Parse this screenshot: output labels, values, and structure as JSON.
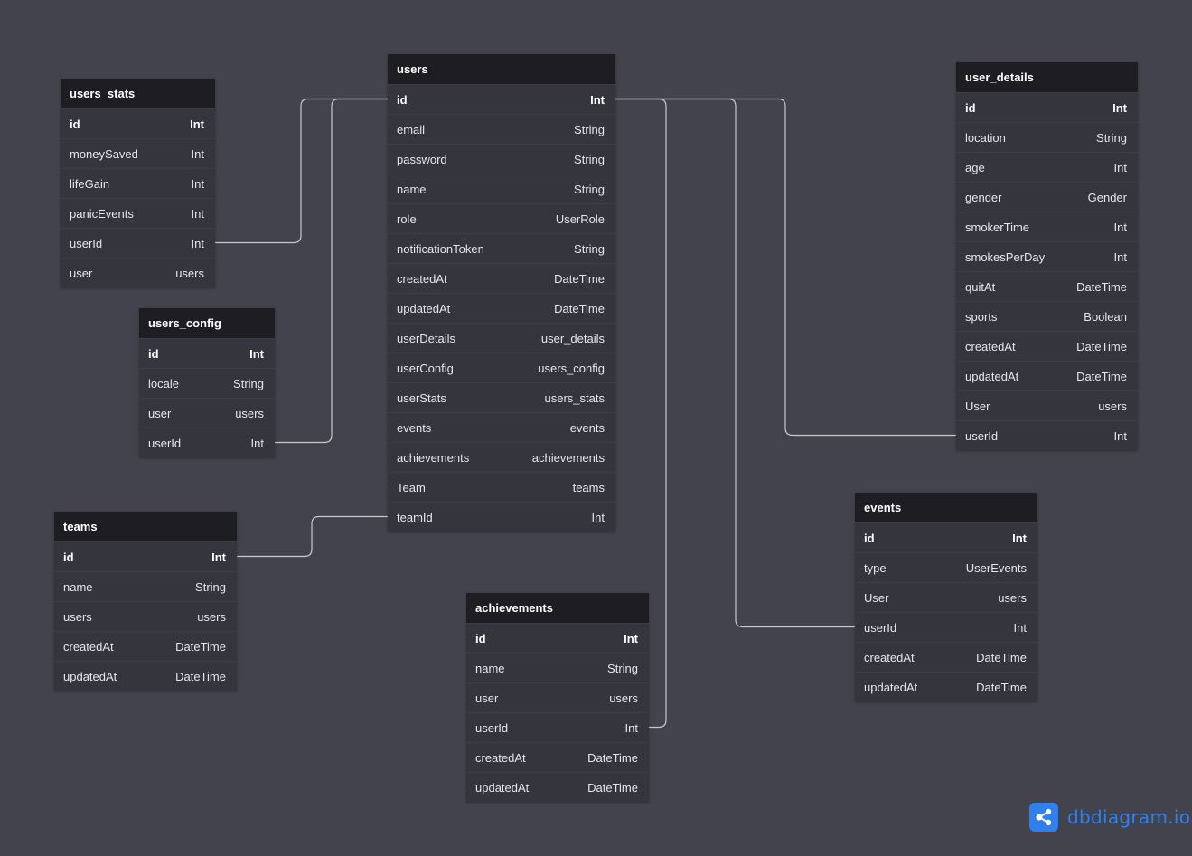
{
  "brand": {
    "name": "dbdiagram.io",
    "icon": "share-network-icon",
    "color": "#2f80ed"
  },
  "colors": {
    "background": "#43434d",
    "table_body": "#35353d",
    "table_header": "#1e1e22",
    "link": "#c8c8d0"
  },
  "tables": [
    {
      "key": "users",
      "name": "users",
      "fields": [
        {
          "name": "id",
          "type": "Int",
          "pk": true
        },
        {
          "name": "email",
          "type": "String"
        },
        {
          "name": "password",
          "type": "String"
        },
        {
          "name": "name",
          "type": "String"
        },
        {
          "name": "role",
          "type": "UserRole"
        },
        {
          "name": "notificationToken",
          "type": "String"
        },
        {
          "name": "createdAt",
          "type": "DateTime"
        },
        {
          "name": "updatedAt",
          "type": "DateTime"
        },
        {
          "name": "userDetails",
          "type": "user_details"
        },
        {
          "name": "userConfig",
          "type": "users_config"
        },
        {
          "name": "userStats",
          "type": "users_stats"
        },
        {
          "name": "events",
          "type": "events"
        },
        {
          "name": "achievements",
          "type": "achievements"
        },
        {
          "name": "Team",
          "type": "teams"
        },
        {
          "name": "teamId",
          "type": "Int"
        }
      ]
    },
    {
      "key": "users_stats",
      "name": "users_stats",
      "fields": [
        {
          "name": "id",
          "type": "Int",
          "pk": true
        },
        {
          "name": "moneySaved",
          "type": "Int"
        },
        {
          "name": "lifeGain",
          "type": "Int"
        },
        {
          "name": "panicEvents",
          "type": "Int"
        },
        {
          "name": "userId",
          "type": "Int"
        },
        {
          "name": "user",
          "type": "users"
        }
      ]
    },
    {
      "key": "users_config",
      "name": "users_config",
      "fields": [
        {
          "name": "id",
          "type": "Int",
          "pk": true
        },
        {
          "name": "locale",
          "type": "String"
        },
        {
          "name": "user",
          "type": "users"
        },
        {
          "name": "userId",
          "type": "Int"
        }
      ]
    },
    {
      "key": "teams",
      "name": "teams",
      "fields": [
        {
          "name": "id",
          "type": "Int",
          "pk": true
        },
        {
          "name": "name",
          "type": "String"
        },
        {
          "name": "users",
          "type": "users"
        },
        {
          "name": "createdAt",
          "type": "DateTime"
        },
        {
          "name": "updatedAt",
          "type": "DateTime"
        }
      ]
    },
    {
      "key": "achievements",
      "name": "achievements",
      "fields": [
        {
          "name": "id",
          "type": "Int",
          "pk": true
        },
        {
          "name": "name",
          "type": "String"
        },
        {
          "name": "user",
          "type": "users"
        },
        {
          "name": "userId",
          "type": "Int"
        },
        {
          "name": "createdAt",
          "type": "DateTime"
        },
        {
          "name": "updatedAt",
          "type": "DateTime"
        }
      ]
    },
    {
      "key": "user_details",
      "name": "user_details",
      "fields": [
        {
          "name": "id",
          "type": "Int",
          "pk": true
        },
        {
          "name": "location",
          "type": "String"
        },
        {
          "name": "age",
          "type": "Int"
        },
        {
          "name": "gender",
          "type": "Gender"
        },
        {
          "name": "smokerTime",
          "type": "Int"
        },
        {
          "name": "smokesPerDay",
          "type": "Int"
        },
        {
          "name": "quitAt",
          "type": "DateTime"
        },
        {
          "name": "sports",
          "type": "Boolean"
        },
        {
          "name": "createdAt",
          "type": "DateTime"
        },
        {
          "name": "updatedAt",
          "type": "DateTime"
        },
        {
          "name": "User",
          "type": "users"
        },
        {
          "name": "userId",
          "type": "Int"
        }
      ]
    },
    {
      "key": "events",
      "name": "events",
      "fields": [
        {
          "name": "id",
          "type": "Int",
          "pk": true
        },
        {
          "name": "type",
          "type": "UserEvents"
        },
        {
          "name": "User",
          "type": "users"
        },
        {
          "name": "userId",
          "type": "Int"
        },
        {
          "name": "createdAt",
          "type": "DateTime"
        },
        {
          "name": "updatedAt",
          "type": "DateTime"
        }
      ]
    }
  ],
  "relations": [
    {
      "from": "users_stats.userId",
      "to": "users.id"
    },
    {
      "from": "users_config.userId",
      "to": "users.id"
    },
    {
      "from": "users.teamId",
      "to": "teams.id"
    },
    {
      "from": "achievements.userId",
      "to": "users.id"
    },
    {
      "from": "events.userId",
      "to": "users.id"
    },
    {
      "from": "user_details.userId",
      "to": "users.id"
    }
  ]
}
